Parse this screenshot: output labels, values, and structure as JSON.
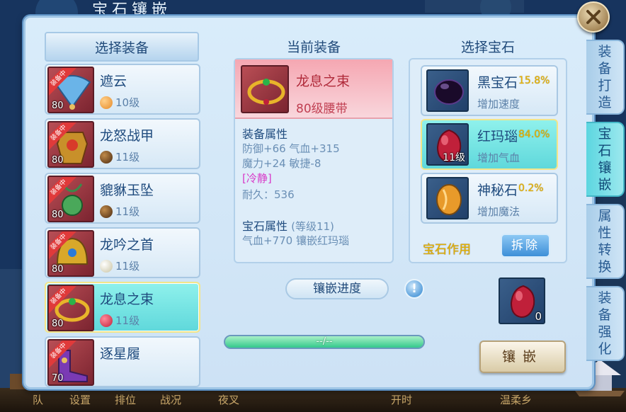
{
  "window_title": "宝石镶嵌",
  "bottom_nav": [
    "队",
    "设置",
    "排位",
    "战况",
    "夜叉",
    "开时",
    "温柔乡"
  ],
  "side_tabs": [
    {
      "label": "装备打造",
      "active": false
    },
    {
      "label": "宝石镶嵌",
      "active": true
    },
    {
      "label": "属性转换",
      "active": false
    },
    {
      "label": "装备强化",
      "active": false
    }
  ],
  "left": {
    "header": "选择装备",
    "ribbon": "装备中",
    "items": [
      {
        "name": "遮云",
        "level": "80",
        "gem": "10级",
        "gem_color": "#e58a2a",
        "equipped": true,
        "selected": false
      },
      {
        "name": "龙怒战甲",
        "level": "80",
        "gem": "11级",
        "gem_color": "#6b3a1a",
        "equipped": true,
        "selected": false
      },
      {
        "name": "貔貅玉坠",
        "level": "80",
        "gem": "11级",
        "gem_color": "#6b3a1a",
        "equipped": true,
        "selected": false
      },
      {
        "name": "龙吟之首",
        "level": "80",
        "gem": "11级",
        "gem_color": "#e8e3c8",
        "equipped": true,
        "selected": false
      },
      {
        "name": "龙息之束",
        "level": "80",
        "gem": "11级",
        "gem_color": "#c0203a",
        "equipped": true,
        "selected": true
      },
      {
        "name": "逐星履",
        "level": "70",
        "gem": "",
        "gem_color": "",
        "equipped": true,
        "selected": false
      }
    ]
  },
  "middle": {
    "title": "当前装备",
    "item_name": "龙息之束",
    "item_type": "80级腰带",
    "attr_header": "装备属性",
    "attr_lines": [
      "防御+66 气血+315",
      "魔力+24 敏捷-8"
    ],
    "special": "[冷静]",
    "durability": "耐久：536",
    "gem_header": "宝石属性",
    "gem_header_level": "(等级11)",
    "gem_line": "气血+770 镶嵌红玛瑙"
  },
  "progress": {
    "label": "镶嵌进度",
    "text": "--/--",
    "fill_fraction": 1.0
  },
  "right": {
    "title": "选择宝石",
    "gems": [
      {
        "name": "黑宝石",
        "pct": "15.8%",
        "desc": "增加速度",
        "count": "",
        "color": "#1a0a2a",
        "selected": false
      },
      {
        "name": "红玛瑙",
        "pct": "84.0%",
        "desc": "增加气血",
        "count": "11级",
        "color": "#c0203a",
        "selected": true
      },
      {
        "name": "神秘石",
        "pct": "0.2%",
        "desc": "增加魔法",
        "count": "",
        "color": "#e89a2a",
        "selected": false
      }
    ],
    "effect_label": "宝石作用",
    "remove_label": "拆除"
  },
  "slot": {
    "count": "0",
    "gem_color": "#c0203a"
  },
  "inlay_label": "镶嵌",
  "colors": {
    "panel_bg": "#d9ecfa",
    "selected_row": "#5fd8db",
    "accent_yellow": "#e8b400"
  }
}
